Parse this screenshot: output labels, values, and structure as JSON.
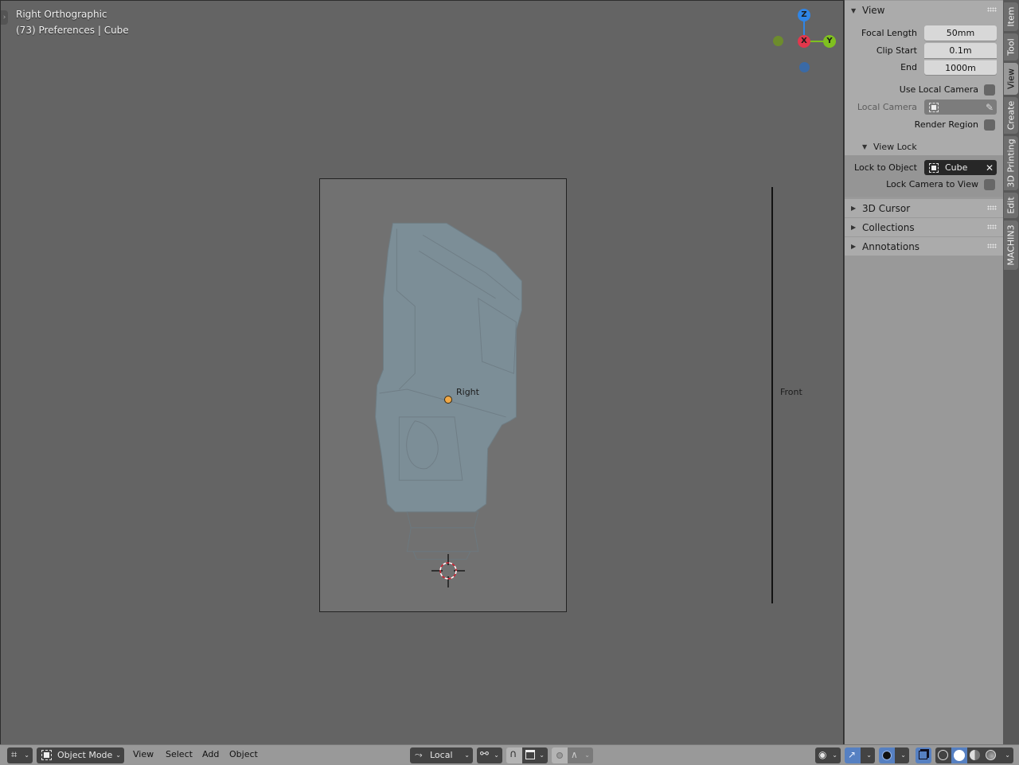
{
  "viewport": {
    "title": "Right Orthographic",
    "subtitle": "(73) Preferences | Cube",
    "camera_label": "Right",
    "front_label": "Front",
    "gizmo": {
      "z_label": "Z",
      "x_label": "X",
      "y_label": "Y",
      "colors": {
        "x": "#e2374c",
        "y": "#7fc01f",
        "z": "#2f85e6"
      }
    }
  },
  "sidebar": {
    "view_panel": {
      "title": "View",
      "focal_length_label": "Focal Length",
      "focal_length_value": "50mm",
      "clip_start_label": "Clip Start",
      "clip_start_value": "0.1m",
      "clip_end_label": "End",
      "clip_end_value": "1000m",
      "use_local_camera_label": "Use Local Camera",
      "use_local_camera_checked": false,
      "local_camera_label": "Local Camera",
      "local_camera_value": "",
      "render_region_label": "Render Region",
      "render_region_checked": false
    },
    "view_lock": {
      "title": "View Lock",
      "lock_to_object_label": "Lock to Object",
      "lock_to_object_value": "Cube",
      "lock_camera_label": "Lock Camera to View",
      "lock_camera_checked": false
    },
    "collapsed_panels": [
      {
        "title": "3D Cursor"
      },
      {
        "title": "Collections"
      },
      {
        "title": "Annotations"
      }
    ],
    "tabs": [
      {
        "label": "Item",
        "active": false
      },
      {
        "label": "Tool",
        "active": false
      },
      {
        "label": "View",
        "active": true
      },
      {
        "label": "Create",
        "active": false
      },
      {
        "label": "3D Printing",
        "active": false
      },
      {
        "label": "Edit",
        "active": false
      },
      {
        "label": "MACHIN3",
        "active": false
      }
    ]
  },
  "header": {
    "editor_type_icon": "3d-viewport-icon",
    "mode": "Object Mode",
    "menus": [
      "View",
      "Select",
      "Add",
      "Object"
    ],
    "transform_orientation": "Local",
    "pivot_icon": "pivot-icon",
    "snap_icon": "magnet-icon",
    "snap_target_icon": "snap-face-icon",
    "proportional_icon": "proportional-edit-icon",
    "falloff_icon": "falloff-curve-icon",
    "visibility_icon": "eye-pointer-icon",
    "gizmo_icon": "gizmo-icon",
    "overlay_icon": "overlay-icon",
    "xray_icon": "xray-icon",
    "shading_modes": [
      "wireframe",
      "solid",
      "material",
      "rendered"
    ],
    "active_shading": "solid"
  }
}
